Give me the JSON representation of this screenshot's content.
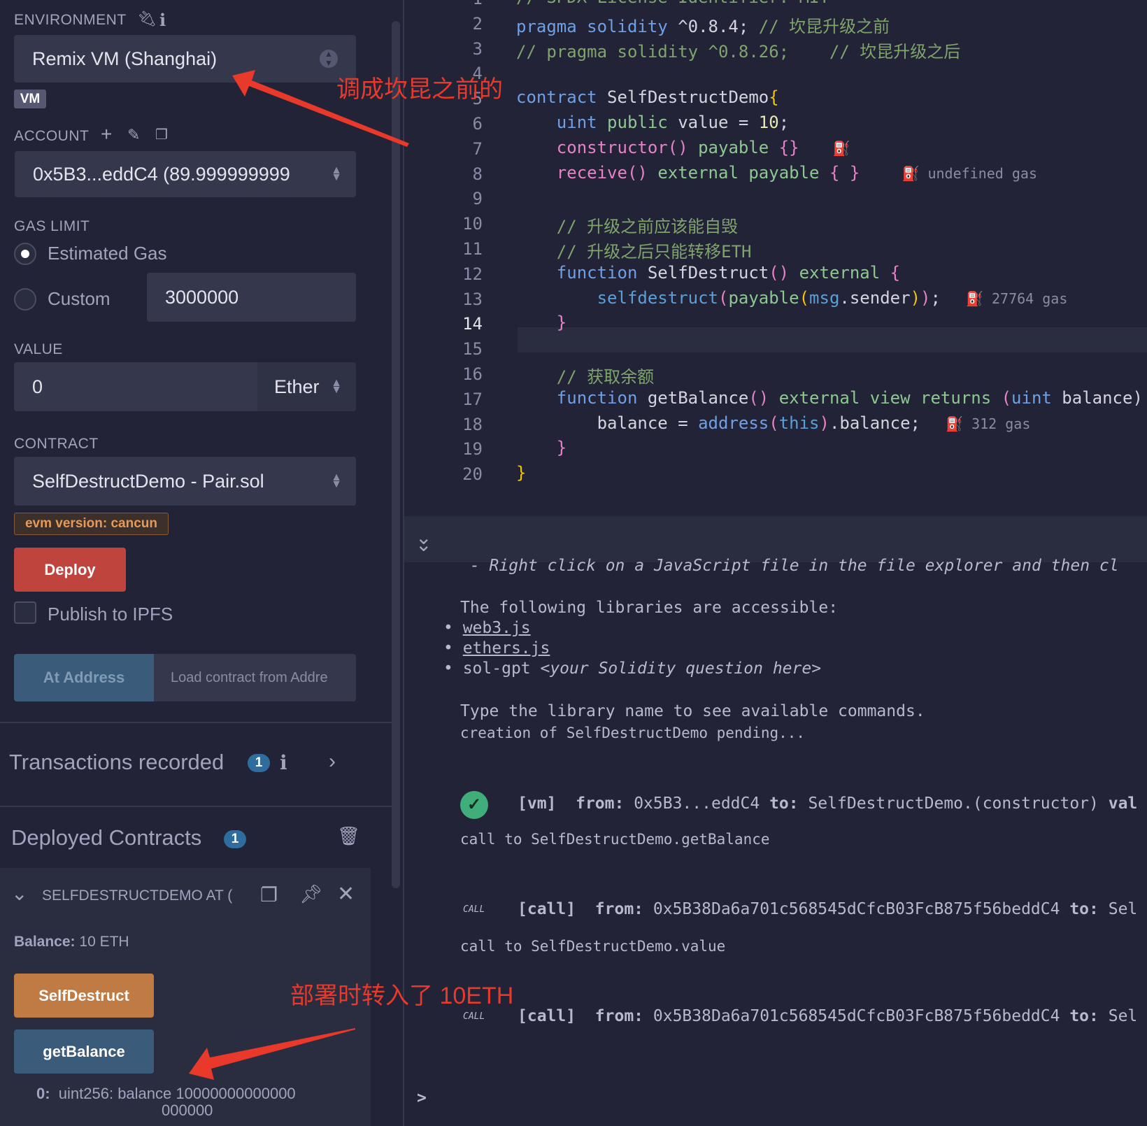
{
  "sidebar": {
    "environment_label": "ENVIRONMENT",
    "environment_value": "Remix VM (Shanghai)",
    "vm_badge": "VM",
    "account_label": "ACCOUNT",
    "account_value": "0x5B3...eddC4 (89.999999999",
    "gas_limit_label": "GAS LIMIT",
    "estimated_gas": "Estimated Gas",
    "custom": "Custom",
    "custom_value": "3000000",
    "value_label": "VALUE",
    "value": "0",
    "unit": "Ether",
    "contract_label": "CONTRACT",
    "contract_value": "SelfDestructDemo - Pair.sol",
    "evm_badge": "evm version: cancun",
    "deploy": "Deploy",
    "publish_ipfs": "Publish to IPFS",
    "at_address": "At Address",
    "at_address_placeholder": "Load contract from Addre",
    "transactions_recorded": "Transactions recorded",
    "transactions_count": "1",
    "deployed_contracts": "Deployed Contracts",
    "deployed_count": "1",
    "instance_title": "SELFDESTRUCTDEMO AT (",
    "balance_label": "Balance:",
    "balance_value": "10 ETH",
    "selfdestruct_btn": "SelfDestruct",
    "getbalance_btn": "getBalance",
    "output_index": "0:",
    "output_line1": "uint256: balance 10000000000000",
    "output_line2": "000000"
  },
  "colors": {
    "selfdestruct": "#c07a44",
    "call": "#3b5b7a",
    "deploy": "#c0443e",
    "annotation": "#e8392a"
  },
  "editor": {
    "active_line": 14,
    "lines": [
      [
        [
          "// SPDX-License-Identifier: MIT",
          "cm"
        ]
      ],
      [
        [
          "pragma solidity ",
          "kw"
        ],
        [
          "^0.8.4; ",
          "tx"
        ],
        [
          "// 坎昆升级之前",
          "cm"
        ]
      ],
      [
        [
          "// pragma solidity ^0.8.26;    // 坎昆升级之后",
          "cm"
        ]
      ],
      [],
      [
        [
          "contract ",
          "kw"
        ],
        [
          "SelfDestructDemo",
          "tx"
        ],
        [
          "{",
          "yb"
        ]
      ],
      [
        [
          "    uint ",
          "kw"
        ],
        [
          "public ",
          "mod"
        ],
        [
          "value = ",
          "tx"
        ],
        [
          "10",
          "num"
        ],
        [
          ";",
          "tx"
        ]
      ],
      [
        [
          "    constructor",
          "fn"
        ],
        [
          "() ",
          "br"
        ],
        [
          "payable ",
          "mod"
        ],
        [
          "{}",
          "br"
        ],
        [
          "    ⛽",
          "gas"
        ]
      ],
      [
        [
          "    receive",
          "fn"
        ],
        [
          "() ",
          "br"
        ],
        [
          "external payable ",
          "mod"
        ],
        [
          "{ }",
          "br"
        ],
        [
          "     ⛽ undefined gas",
          "gas"
        ]
      ],
      [],
      [
        [
          "    // 升级之前应该能自毁",
          "cm"
        ]
      ],
      [
        [
          "    // 升级之后只能转移ETH",
          "cm"
        ]
      ],
      [
        [
          "    function ",
          "kw"
        ],
        [
          "SelfDestruct",
          "tx"
        ],
        [
          "() ",
          "br"
        ],
        [
          "external ",
          "mod"
        ],
        [
          "{",
          "br"
        ]
      ],
      [
        [
          "        selfdestruct",
          "bi"
        ],
        [
          "(",
          "br"
        ],
        [
          "payable",
          "mod"
        ],
        [
          "(",
          "yb"
        ],
        [
          "msg",
          "bi"
        ],
        [
          ".sender",
          "tx"
        ],
        [
          ")",
          "yb"
        ],
        [
          ")",
          "br"
        ],
        [
          ";",
          "tx"
        ],
        [
          "   ⛽ 27764 gas",
          "gas"
        ]
      ],
      [
        [
          "    }",
          "br"
        ]
      ],
      [],
      [
        [
          "    // 获取余额",
          "cm"
        ]
      ],
      [
        [
          "    function ",
          "kw"
        ],
        [
          "getBalance",
          "tx"
        ],
        [
          "() ",
          "br"
        ],
        [
          "external view returns ",
          "mod"
        ],
        [
          "(",
          "br"
        ],
        [
          "uint ",
          "kw"
        ],
        [
          "balance)",
          "tx"
        ]
      ],
      [
        [
          "        balance = ",
          "tx"
        ],
        [
          "address",
          "kw"
        ],
        [
          "(",
          "br"
        ],
        [
          "this",
          "bi"
        ],
        [
          ")",
          "br"
        ],
        [
          ".balance;",
          "tx"
        ],
        [
          "   ⛽ 312 gas",
          "gas"
        ]
      ],
      [
        [
          "    }",
          "br"
        ]
      ],
      [
        [
          "}",
          "yb"
        ]
      ]
    ]
  },
  "terminal": {
    "line_hint": " - Right click on a JavaScript file in the file explorer and then cl",
    "libs_intro": "The following libraries are accessible:",
    "lib1": "web3.js",
    "lib2": "ethers.js",
    "lib3_cmd": "sol-gpt ",
    "lib3_arg": "<your Solidity question here>",
    "type_hint": "Type the library name to see available commands.",
    "pending": "creation of SelfDestructDemo pending...",
    "tx1_tag": "[vm]",
    "tx1_from_label": "from:",
    "tx1_from": " 0x5B3...eddC4 ",
    "tx1_to_label": "to:",
    "tx1_to": " SelfDestructDemo.(constructor) ",
    "tx1_val": "val",
    "call1_text": "call to SelfDestructDemo.getBalance",
    "call_badge": "CALL",
    "call_tag": "[call]",
    "call_from": " 0x5B38Da6a701c568545dCfcB03FcB875f56beddC4 ",
    "call_to": " Sel",
    "call2_text": "call to SelfDestructDemo.value",
    "prompt": ">"
  },
  "annotations": {
    "env_note": "调成坎昆之前的",
    "deploy_note": "部署时转入了 10ETH"
  }
}
